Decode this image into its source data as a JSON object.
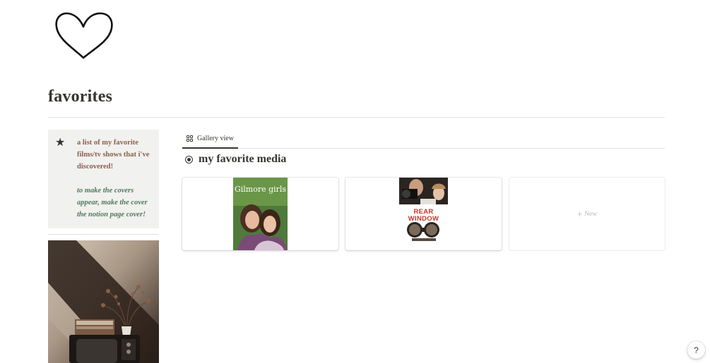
{
  "page": {
    "icon": "heart-outline-icon",
    "title": "favorites"
  },
  "callout": {
    "icon": "star-icon",
    "text_1": "a list of my favorite films/tv shows that i've discovered!",
    "text_2": "to make the covers appear, make the  cover the notion page cover!",
    "colors": {
      "text_1": "#8a5f4e",
      "text_2": "#4f7a5a",
      "background": "#f1f1ef"
    }
  },
  "sidebar_image": {
    "icon": "vintage-tv-photo"
  },
  "database": {
    "view_tab": {
      "label": "Gallery view",
      "icon": "gallery-grid-icon"
    },
    "title": "my favorite media",
    "title_icon": "target-icon",
    "cards": [
      {
        "cover": "gilmore-girls-poster",
        "cover_text": "Gilmore girls"
      },
      {
        "cover": "rear-window-poster",
        "cover_text_1": "REAR",
        "cover_text_2": "WINDOW"
      }
    ],
    "new_card": {
      "icon": "plus-icon",
      "label": "New"
    }
  },
  "help_button": {
    "label": "?"
  }
}
